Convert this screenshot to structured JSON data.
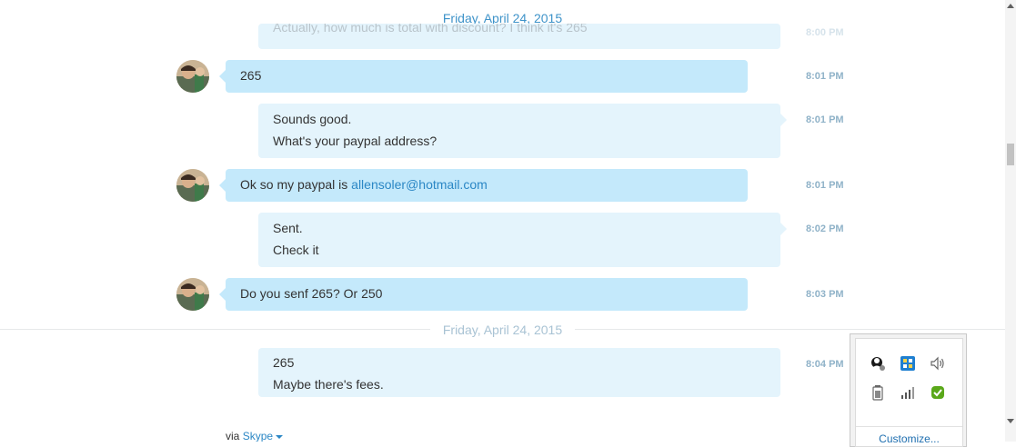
{
  "chat": {
    "date_separators": [
      "Friday, April 24, 2015",
      "Friday, April 24, 2015"
    ],
    "partial_previous_message": "Actually, how much is total with discount? I think it's 265",
    "partial_previous_time": "8:00 PM",
    "messages": [
      {
        "sender": "them",
        "lines": [
          "265"
        ],
        "time": "8:01 PM"
      },
      {
        "sender": "me",
        "lines": [
          "Sounds good.",
          "What's your paypal address?"
        ],
        "time": "8:01 PM"
      },
      {
        "sender": "them",
        "text_before_link": "Ok so my paypal is ",
        "link": "allensoler@hotmail.com",
        "time": "8:01 PM"
      },
      {
        "sender": "me",
        "lines": [
          "Sent.",
          "Check it"
        ],
        "time": "8:02 PM"
      },
      {
        "sender": "them",
        "lines": [
          "Do you senf 265? Or 250"
        ],
        "time": "8:03 PM"
      },
      {
        "sender": "me",
        "lines": [
          "265",
          "Maybe there's fees."
        ],
        "time": "8:04 PM"
      }
    ],
    "via_label": "via",
    "via_link": "Skype",
    "colors": {
      "accent": "#2b87c5",
      "them_bubble": "#c4e9fb",
      "me_bubble": "#e4f4fc",
      "timestamp": "#8fb2c8"
    }
  },
  "tray": {
    "icons": [
      "skype-tray-icon",
      "network-app-icon",
      "volume-icon",
      "battery-icon",
      "signal-icon",
      "security-shield-icon"
    ],
    "customize_label": "Customize..."
  }
}
